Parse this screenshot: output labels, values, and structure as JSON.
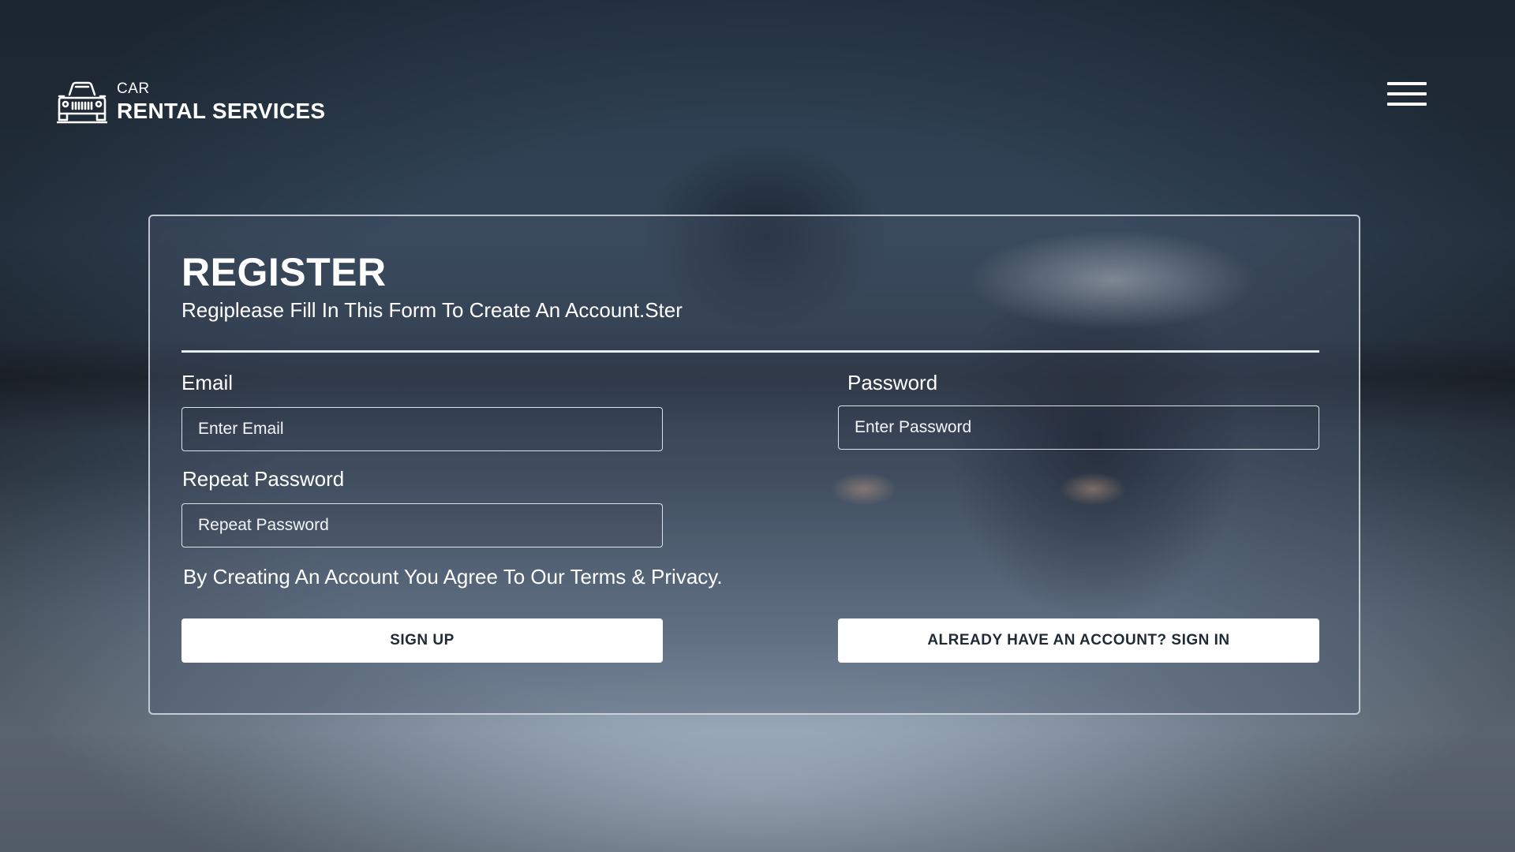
{
  "brand": {
    "small": "CAR",
    "big": "RENTAL SERVICES",
    "icon": "car-icon"
  },
  "nav": {
    "menu_icon": "hamburger-menu-icon"
  },
  "form": {
    "title": "REGISTER",
    "subtitle": "Regiplease Fill In This Form To Create An Account.Ster",
    "email": {
      "label": "Email",
      "placeholder": "Enter Email",
      "value": ""
    },
    "password": {
      "label": "Password",
      "placeholder": "Enter Password",
      "value": ""
    },
    "repeat_password": {
      "label": "Repeat Password",
      "placeholder": "Repeat Password",
      "value": ""
    },
    "terms": "By Creating An Account You Agree To Our Terms & Privacy.",
    "signup_label": "SIGN UP",
    "signin_label": "ALREADY HAVE AN ACCOUNT? SIGN IN"
  },
  "colors": {
    "text": "#ffffff",
    "button_bg": "#ffffff",
    "button_text": "#1f2a36"
  }
}
